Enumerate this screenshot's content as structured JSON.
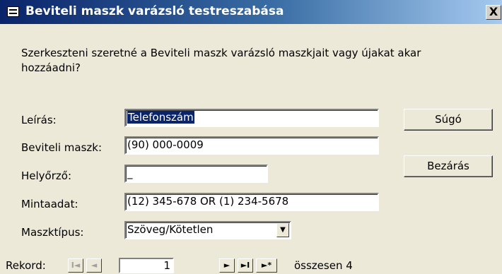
{
  "window": {
    "title": "Beviteli maszk varázsló testreszabása",
    "close_label": "X"
  },
  "prompt": "Szerkeszteni szeretné a Beviteli maszk varázsló maszkjait vagy újakat akar hozzáadni?",
  "form": {
    "description_label": "Leírás:",
    "description_value": "Telefonszám",
    "mask_label": "Beviteli maszk:",
    "mask_value": "(90) 000-0009",
    "placeholder_label": "Helyőrző:",
    "placeholder_value": "_",
    "sample_label": "Mintaadat:",
    "sample_value": "(12) 345-678 OR (1) 234-5678",
    "masktype_label": "Maszktípus:",
    "masktype_value": "Szöveg/Kötetlen"
  },
  "buttons": {
    "help": "Súgó",
    "close": "Bezárás"
  },
  "record_nav": {
    "label": "Rekord:",
    "first": "I◄",
    "prev": "◄",
    "current": "1",
    "next": "►",
    "last": "►I",
    "new": "►*",
    "total": "összesen 4"
  }
}
